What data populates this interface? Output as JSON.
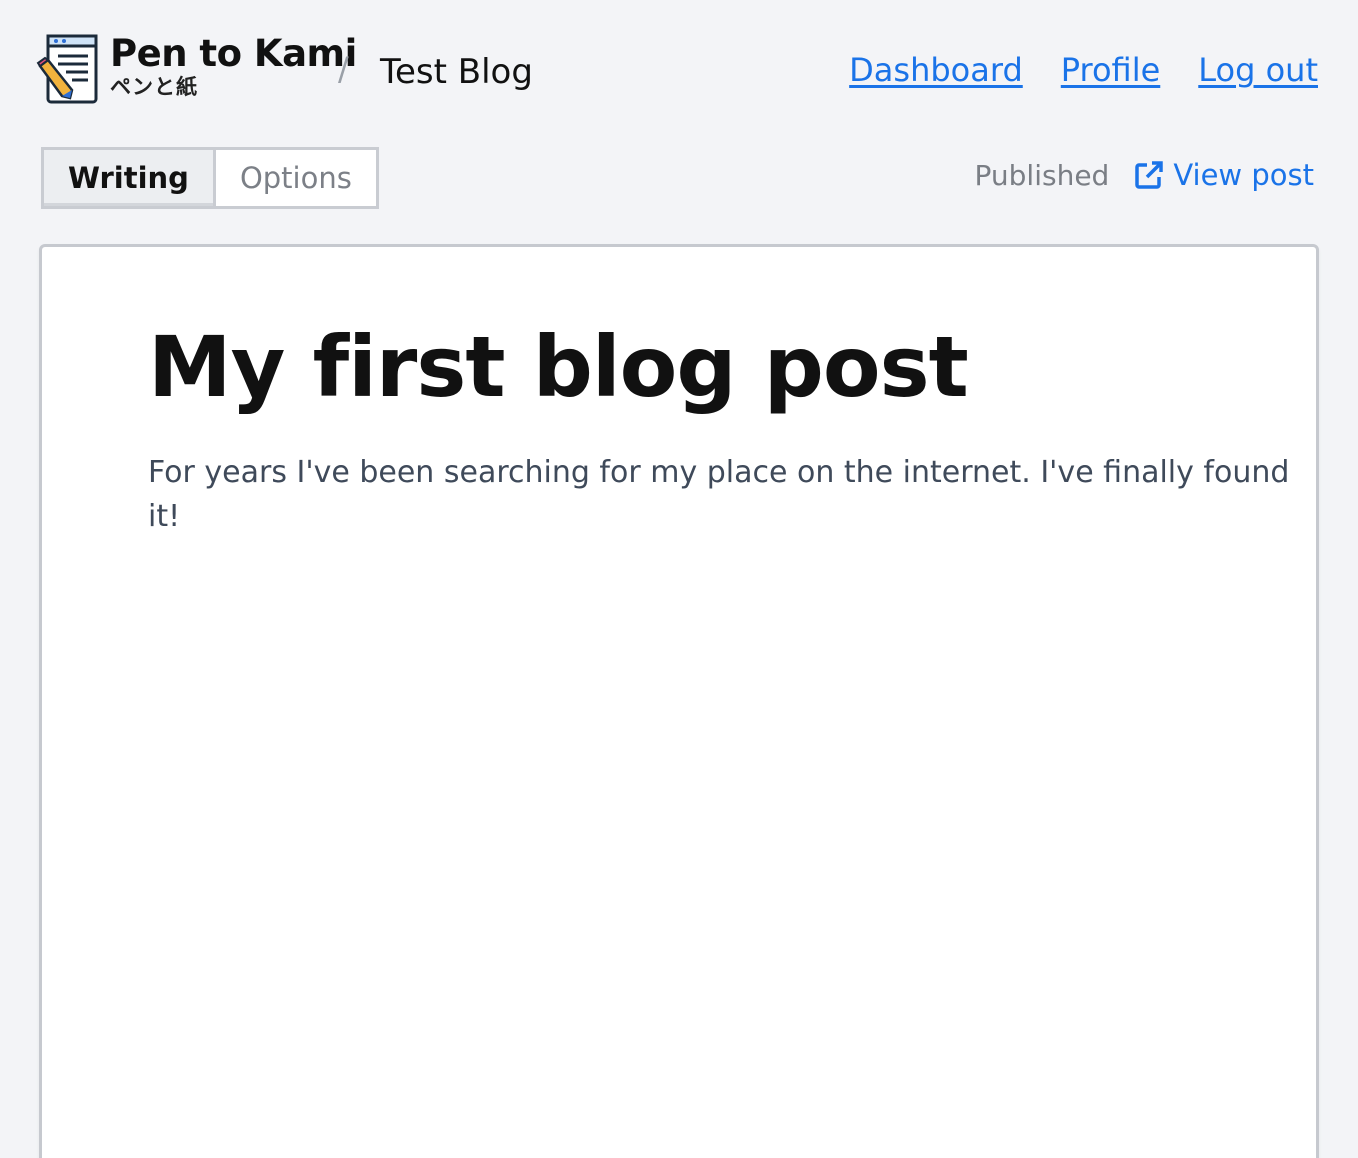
{
  "brand": {
    "name": "Pen to Kami",
    "subtitle": "ペンと紙",
    "icon": "notepad-pencil-icon"
  },
  "breadcrumb": {
    "separator": "/",
    "blog_name": "Test Blog"
  },
  "nav": {
    "dashboard": "Dashboard",
    "profile": "Profile",
    "logout": "Log out"
  },
  "tabs": {
    "writing": "Writing",
    "options": "Options"
  },
  "status": {
    "state": "Published",
    "view_post": "View post",
    "view_icon": "external-link-icon"
  },
  "post": {
    "title": "My first blog post",
    "body": "For years I've been searching for my place on the internet. I've finally found it!"
  },
  "colors": {
    "link": "#1a73e8",
    "background": "#f3f4f7",
    "editor_bg": "#ffffff",
    "body_text": "#3f4a5a"
  }
}
